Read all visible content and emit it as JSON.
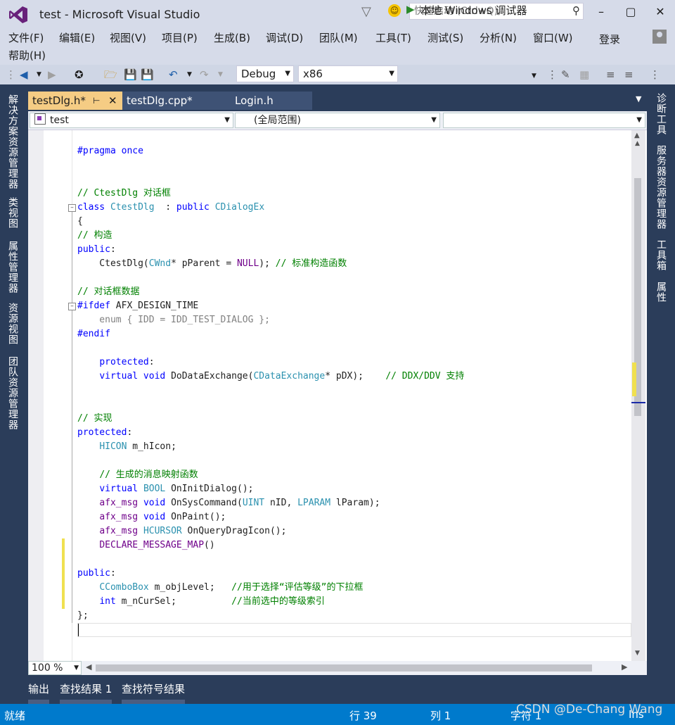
{
  "window": {
    "title": "test - Microsoft Visual Studio",
    "quick_launch_placeholder": "快速启动 (Ctrl+Q)",
    "login": "登录"
  },
  "menu": [
    "文件(F)",
    "编辑(E)",
    "视图(V)",
    "项目(P)",
    "生成(B)",
    "调试(D)",
    "团队(M)",
    "工具(T)",
    "测试(S)",
    "分析(N)",
    "窗口(W)",
    "帮助(H)"
  ],
  "toolbar": {
    "config": "Debug",
    "platform": "x86",
    "run_label": "本地 Windows 调试器"
  },
  "left_panels": [
    "解决方案资源管理器",
    "类视图",
    "属性管理器",
    "资源视图",
    "团队资源管理器"
  ],
  "right_panels": [
    "诊断工具",
    "服务器资源管理器",
    "工具箱",
    "属性"
  ],
  "tabs": [
    {
      "label": "testDlg.h*",
      "active": true
    },
    {
      "label": "testDlg.cpp*",
      "active": false
    },
    {
      "label": "Login.h",
      "active": false
    }
  ],
  "navbar": {
    "project": "test",
    "scope": "(全局范围)",
    "member": ""
  },
  "code_lines": [
    {
      "parts": [
        [
          "pp",
          "#pragma once"
        ]
      ]
    },
    {
      "parts": []
    },
    {
      "parts": []
    },
    {
      "parts": [
        [
          "cm",
          "// CtestDlg 对话框"
        ]
      ]
    },
    {
      "parts": [
        [
          "kw",
          "class "
        ],
        [
          "ty",
          "CtestDlg"
        ],
        [
          "",
          "  : "
        ],
        [
          "kw",
          "public "
        ],
        [
          "ty",
          "CDialogEx"
        ]
      ]
    },
    {
      "parts": [
        [
          "",
          "{"
        ]
      ]
    },
    {
      "parts": [
        [
          "cm",
          "// 构造"
        ]
      ]
    },
    {
      "parts": [
        [
          "kw",
          "public"
        ],
        [
          "",
          ":"
        ]
      ]
    },
    {
      "parts": [
        [
          "",
          "    CtestDlg("
        ],
        [
          "ty",
          "CWnd"
        ],
        [
          "",
          "* pParent = "
        ],
        [
          "mac",
          "NULL"
        ],
        [
          "",
          "); "
        ],
        [
          "cm",
          "// 标准构造函数"
        ]
      ]
    },
    {
      "parts": []
    },
    {
      "parts": [
        [
          "cm",
          "// 对话框数据"
        ]
      ]
    },
    {
      "parts": [
        [
          "pp",
          "#ifdef"
        ],
        [
          "",
          " AFX_DESIGN_TIME"
        ]
      ]
    },
    {
      "parts": [
        [
          "ina",
          "    enum { IDD = IDD_TEST_DIALOG };"
        ]
      ]
    },
    {
      "parts": [
        [
          "pp",
          "#endif"
        ]
      ]
    },
    {
      "parts": []
    },
    {
      "parts": [
        [
          "",
          "    "
        ],
        [
          "kw",
          "protected"
        ],
        [
          "",
          ":"
        ]
      ]
    },
    {
      "parts": [
        [
          "",
          "    "
        ],
        [
          "kw",
          "virtual void "
        ],
        [
          "",
          "DoDataExchange("
        ],
        [
          "ty",
          "CDataExchange"
        ],
        [
          "",
          "* pDX);    "
        ],
        [
          "cm",
          "// DDX/DDV 支持"
        ]
      ]
    },
    {
      "parts": []
    },
    {
      "parts": []
    },
    {
      "parts": [
        [
          "cm",
          "// 实现"
        ]
      ]
    },
    {
      "parts": [
        [
          "kw",
          "protected"
        ],
        [
          "",
          ":"
        ]
      ]
    },
    {
      "parts": [
        [
          "",
          "    "
        ],
        [
          "ty",
          "HICON"
        ],
        [
          "",
          " m_hIcon;"
        ]
      ]
    },
    {
      "parts": []
    },
    {
      "parts": [
        [
          "",
          "    "
        ],
        [
          "cm",
          "// 生成的消息映射函数"
        ]
      ]
    },
    {
      "parts": [
        [
          "",
          "    "
        ],
        [
          "kw",
          "virtual "
        ],
        [
          "ty",
          "BOOL"
        ],
        [
          "",
          " OnInitDialog();"
        ]
      ]
    },
    {
      "parts": [
        [
          "",
          "    "
        ],
        [
          "mac",
          "afx_msg "
        ],
        [
          "kw",
          "void "
        ],
        [
          "",
          "OnSysCommand("
        ],
        [
          "ty",
          "UINT"
        ],
        [
          "",
          " nID, "
        ],
        [
          "ty",
          "LPARAM"
        ],
        [
          "",
          " lParam);"
        ]
      ]
    },
    {
      "parts": [
        [
          "",
          "    "
        ],
        [
          "mac",
          "afx_msg "
        ],
        [
          "kw",
          "void "
        ],
        [
          "",
          "OnPaint();"
        ]
      ]
    },
    {
      "parts": [
        [
          "",
          "    "
        ],
        [
          "mac",
          "afx_msg "
        ],
        [
          "ty",
          "HCURSOR"
        ],
        [
          "",
          " OnQueryDragIcon();"
        ]
      ]
    },
    {
      "parts": [
        [
          "",
          "    "
        ],
        [
          "mac",
          "DECLARE_MESSAGE_MAP"
        ],
        [
          "",
          "()"
        ]
      ]
    },
    {
      "parts": []
    },
    {
      "parts": [
        [
          "kw",
          "public"
        ],
        [
          "",
          ":"
        ]
      ]
    },
    {
      "parts": [
        [
          "",
          "    "
        ],
        [
          "ty",
          "CComboBox"
        ],
        [
          "",
          " m_objLevel;   "
        ],
        [
          "cm",
          "//用于选择“评估等级”的下拉框"
        ]
      ]
    },
    {
      "parts": [
        [
          "",
          "    "
        ],
        [
          "kw",
          "int"
        ],
        [
          "",
          " m_nCurSel;          "
        ],
        [
          "cm",
          "//当前选中的等级索引"
        ]
      ]
    },
    {
      "parts": [
        [
          "",
          "};"
        ]
      ]
    }
  ],
  "zoom": "100 %",
  "bottom_tabs": [
    "输出",
    "查找结果 1",
    "查找符号结果"
  ],
  "status": {
    "state": "就绪",
    "line": "行 39",
    "col": "列 1",
    "char": "字符 1",
    "ins": "Ins"
  },
  "watermark": "CSDN @De-Chang Wang"
}
